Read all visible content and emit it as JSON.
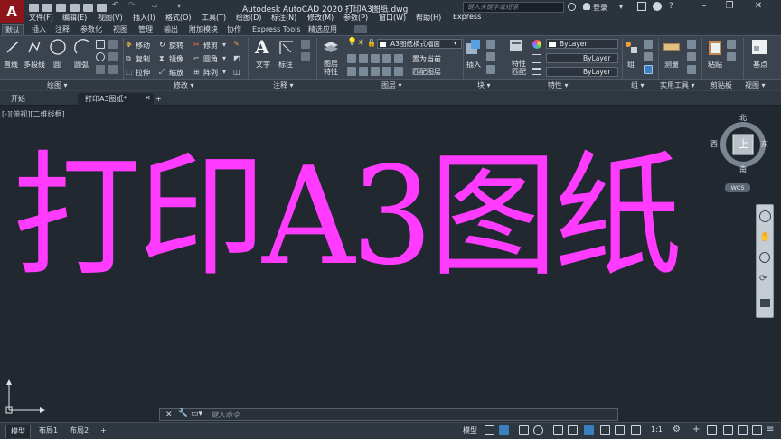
{
  "app": {
    "logo_letter": "A",
    "title": "Autodesk AutoCAD 2020    打印A3图纸.dwg",
    "search_placeholder": "键入关键字或短语",
    "login": "登录",
    "window_controls": [
      "minimize-icon",
      "maximize-icon",
      "close-icon"
    ]
  },
  "menu": [
    "文件(F)",
    "编辑(E)",
    "视图(V)",
    "插入(I)",
    "格式(O)",
    "工具(T)",
    "绘图(D)",
    "标注(N)",
    "修改(M)",
    "参数(P)",
    "窗口(W)",
    "帮助(H)",
    "Express"
  ],
  "ribbon_tabs": [
    "默认",
    "插入",
    "注释",
    "参数化",
    "视图",
    "管理",
    "输出",
    "附加模块",
    "协作",
    "Express Tools",
    "精选应用"
  ],
  "ribbon": {
    "draw": {
      "line": "直线",
      "polyline": "多段线",
      "circle": "圆",
      "arc": "圆弧"
    },
    "modify": {
      "move": "移动",
      "rotate": "旋转",
      "trim": "修剪",
      "copy": "复制",
      "mirror": "镜像",
      "fillet": "圆角",
      "stretch": "拉伸",
      "scale": "缩放",
      "array": "阵列"
    },
    "annotation": {
      "text": "文字",
      "dimension": "标注"
    },
    "layers": {
      "properties": "图层\n特性",
      "current_layer": "A3图纸横式幅面",
      "set_current": "置为当前",
      "match": "匹配图层"
    },
    "block": {
      "insert": "插入"
    },
    "properties": {
      "match": "特性\n匹配",
      "color": "ByLayer",
      "linetype": "ByLayer",
      "lineweight": "ByLayer"
    },
    "group": {
      "group": "组"
    },
    "utilities": {
      "measure": "测量"
    },
    "clipboard": {
      "paste": "粘贴"
    },
    "view": {
      "base": "基点"
    }
  },
  "panel_labels": [
    "绘图 ▾",
    "修改 ▾",
    "注释 ▾",
    "图层 ▾",
    "块 ▾",
    "特性 ▾",
    "组 ▾",
    "实用工具 ▾",
    "剪贴板",
    "视图 ▾"
  ],
  "doc_tabs": {
    "start": "开始",
    "current": "打印A3图纸*",
    "add": "+"
  },
  "viewport": {
    "label": "[-][俯视][二维线框]",
    "drawing_text": "打印A3图纸",
    "drawing_color": "#ff3bff",
    "viewcube": {
      "top": "上",
      "north": "北",
      "south": "南",
      "east": "东",
      "west": "西",
      "wcs": "WCS"
    }
  },
  "command_line": {
    "placeholder": "键入命令"
  },
  "status": {
    "layout_tabs": [
      "模型",
      "布局1",
      "布局2",
      "+"
    ],
    "model_label": "模型",
    "scale": "1:1"
  }
}
